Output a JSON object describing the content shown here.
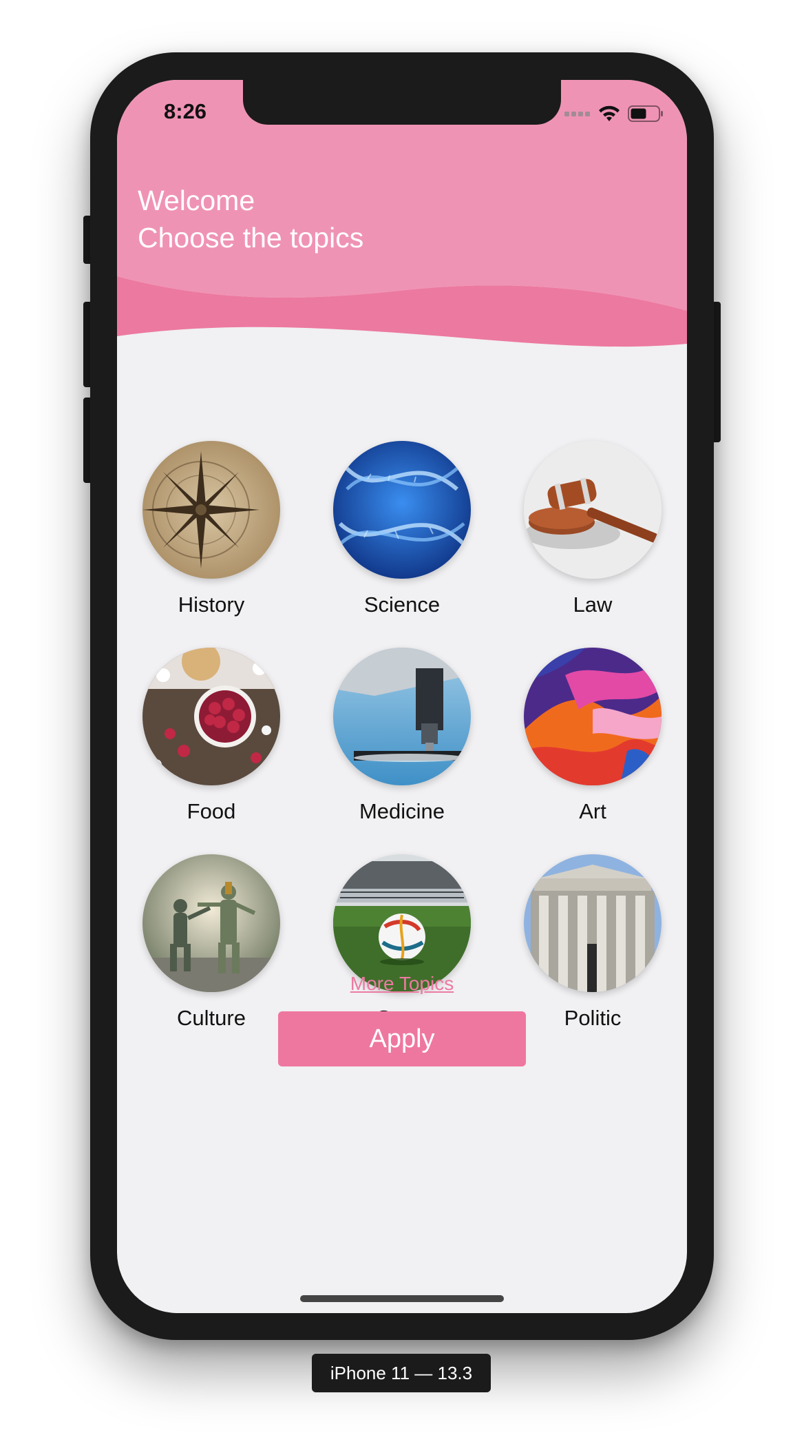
{
  "status_bar": {
    "time": "8:26",
    "icons": [
      "cellular-icon",
      "wifi-icon",
      "battery-icon"
    ]
  },
  "header": {
    "line1": "Welcome",
    "line2": "Choose the topics",
    "colors": {
      "light_pink": "#ef93b4",
      "dark_pink": "#ec79a0"
    }
  },
  "topics": [
    {
      "label": "History"
    },
    {
      "label": "Science"
    },
    {
      "label": "Law"
    },
    {
      "label": "Food"
    },
    {
      "label": "Medicine"
    },
    {
      "label": "Art"
    },
    {
      "label": "Culture"
    },
    {
      "label": "Sport"
    },
    {
      "label": "Politic"
    }
  ],
  "more_topics": "More Topics",
  "apply_label": "Apply",
  "device_label": "iPhone 11 — 13.3",
  "colors": {
    "accent": "#ee77a0",
    "screen_bg": "#f1f0f2",
    "frame": "#1b1b1b"
  }
}
